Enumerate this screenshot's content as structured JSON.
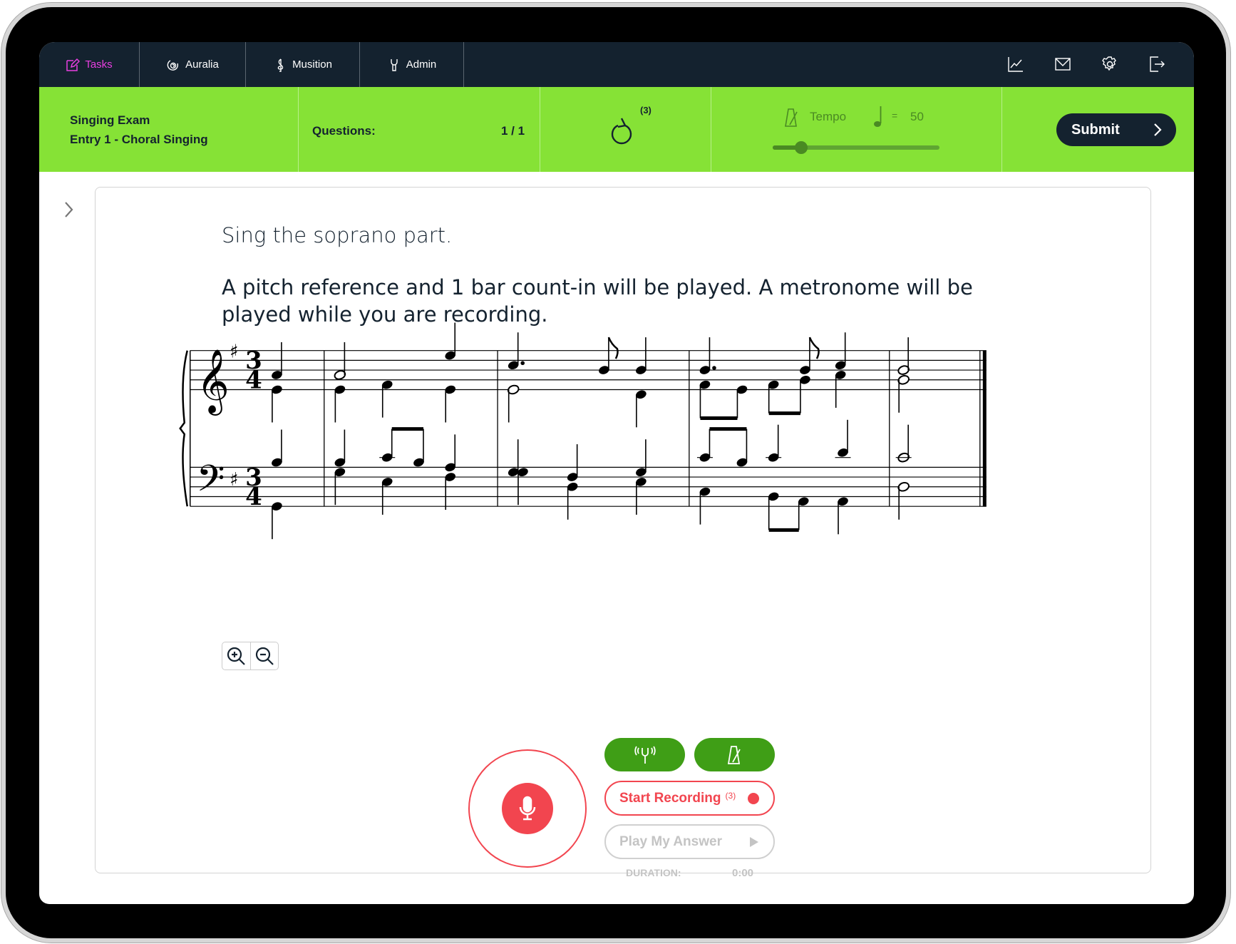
{
  "nav": {
    "items": [
      {
        "label": "Tasks",
        "icon": "pencil-square-icon",
        "active": true
      },
      {
        "label": "Auralia",
        "icon": "ear-icon"
      },
      {
        "label": "Musition",
        "icon": "treble-clef-icon"
      },
      {
        "label": "Admin",
        "icon": "wrench-icon"
      }
    ],
    "right_icons": [
      "chart-icon",
      "mail-icon",
      "gear-icon",
      "logout-icon"
    ]
  },
  "exam": {
    "title": "Singing Exam",
    "subtitle": "Entry 1 - Choral Singing",
    "questions_label": "Questions:",
    "questions_value": "1 / 1",
    "retry_count": "(3)",
    "tempo_label": "Tempo",
    "tempo_eq": "=",
    "tempo_value": "50",
    "tempo_slider_fraction": 0.17,
    "submit_label": "Submit"
  },
  "question": {
    "instruction": "Sing the soprano part.",
    "details": "A pitch reference and 1 bar count-in will be played. A metronome will be played while you are recording.",
    "time_signature": "3/4",
    "key_signature": "G major (1 sharp)"
  },
  "controls": {
    "start_recording": "Start Recording",
    "start_recording_count": "(3)",
    "play_answer": "Play My Answer",
    "duration_label": "DURATION:",
    "duration_value": "0:00"
  },
  "colors": {
    "nav": "#14222f",
    "green_bar": "#86e236",
    "tasks_accent": "#e83fe0",
    "record_red": "#f2454f",
    "button_green": "#3f9e16"
  }
}
